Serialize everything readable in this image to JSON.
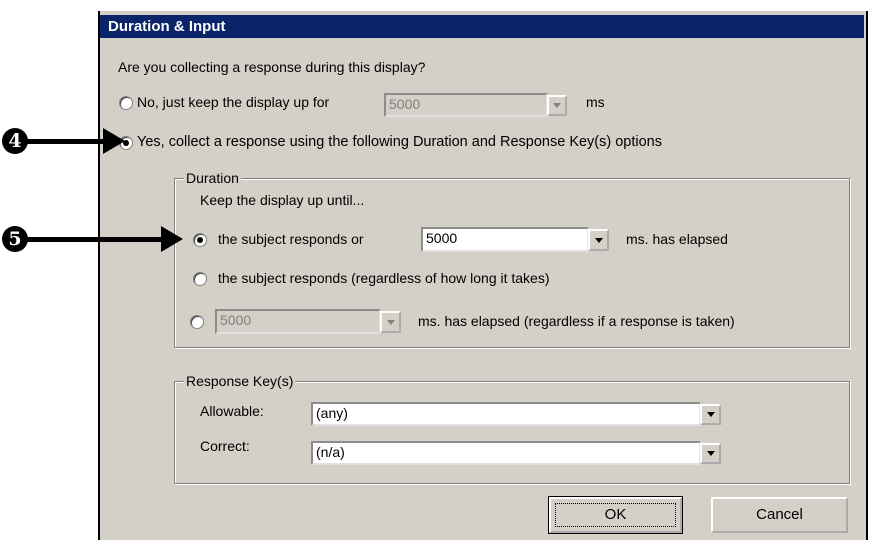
{
  "dialog": {
    "title": "Duration & Input",
    "question": "Are you collecting a response during this display?",
    "option_no": {
      "label": "No, just keep the display up for",
      "value": "5000",
      "unit": "ms",
      "checked": false
    },
    "option_yes": {
      "label": "Yes, collect a response using the following Duration and Response Key(s) options",
      "checked": true
    }
  },
  "duration": {
    "legend": "Duration",
    "prompt": "Keep the display up until...",
    "option1": {
      "label": "the subject responds or",
      "value": "5000",
      "suffix": "ms. has elapsed",
      "checked": true
    },
    "option2": {
      "label": "the subject responds (regardless of how long it takes)",
      "checked": false
    },
    "option3": {
      "value": "5000",
      "suffix": "ms. has elapsed (regardless if a response is taken)",
      "checked": false
    }
  },
  "response_keys": {
    "legend": "Response Key(s)",
    "allowable_label": "Allowable:",
    "allowable_value": "(any)",
    "correct_label": "Correct:",
    "correct_value": "(n/a)"
  },
  "buttons": {
    "ok": "OK",
    "cancel": "Cancel"
  },
  "annotations": [
    {
      "number": "4",
      "icon": "circled-digit-four"
    },
    {
      "number": "5",
      "icon": "circled-digit-five"
    }
  ]
}
